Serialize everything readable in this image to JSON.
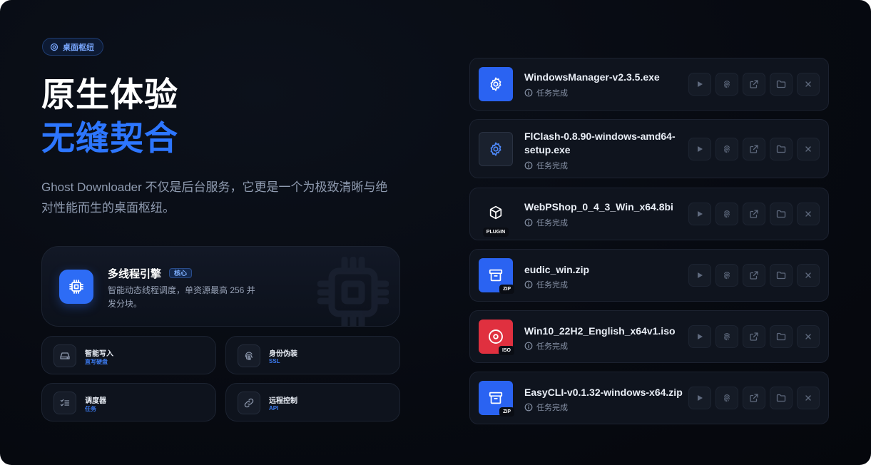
{
  "hero": {
    "pill_label": "桌面枢纽",
    "title_line1": "原生体验",
    "title_line2": "无缝契合",
    "description": "Ghost Downloader 不仅是后台服务，它更是一个为极致清晰与绝对性能而生的桌面枢纽。"
  },
  "feature": {
    "title": "多线程引擎",
    "badge": "核心",
    "description": "智能动态线程调度，单资源最高 256 并发分块。",
    "icon": "cpu-icon"
  },
  "mini_features": [
    {
      "title": "智能写入",
      "sub": "直写硬盘",
      "icon": "drive-icon"
    },
    {
      "title": "身份伪装",
      "sub": "SSL",
      "icon": "fingerprint-icon"
    },
    {
      "title": "调度器",
      "sub": "任务",
      "icon": "checklist-icon"
    },
    {
      "title": "远程控制",
      "sub": "API",
      "icon": "link-icon"
    }
  ],
  "downloads": [
    {
      "name": "WindowsManager-v2.3.5.exe",
      "status": "任务完成",
      "icon": "gear-icon",
      "style": "blue",
      "tag": ""
    },
    {
      "name": "FlClash-0.8.90-windows-amd64-setup.exe",
      "status": "任务完成",
      "icon": "gear-icon",
      "style": "dark",
      "tag": ""
    },
    {
      "name": "WebPShop_0_4_3_Win_x64.8bi",
      "status": "任务完成",
      "icon": "cube-icon",
      "style": "none",
      "tag": "PLUGIN"
    },
    {
      "name": "eudic_win.zip",
      "status": "任务完成",
      "icon": "archive-icon",
      "style": "blue",
      "tag": "ZIP"
    },
    {
      "name": "Win10_22H2_English_x64v1.iso",
      "status": "任务完成",
      "icon": "disc-icon",
      "style": "red",
      "tag": "ISO"
    },
    {
      "name": "EasyCLI-v0.1.32-windows-x64.zip",
      "status": "任务完成",
      "icon": "archive-icon",
      "style": "blue",
      "tag": "ZIP"
    }
  ],
  "colors": {
    "accent": "#2d76ff",
    "red": "#e0303f"
  }
}
